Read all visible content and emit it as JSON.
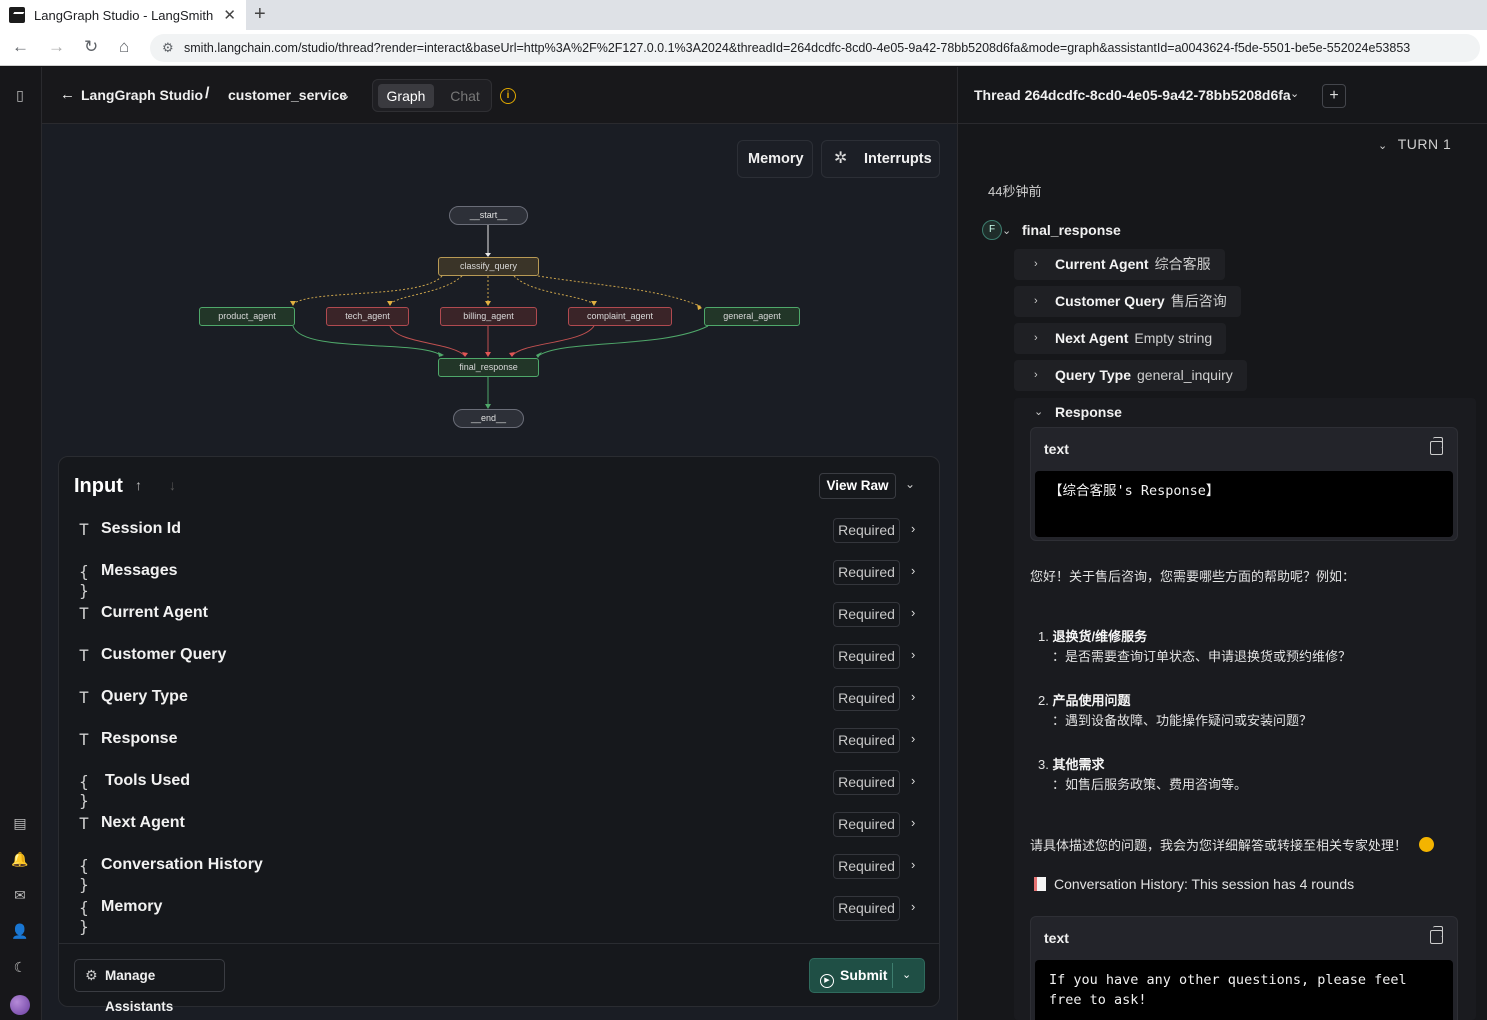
{
  "browser": {
    "tab_title": "LangGraph Studio - LangSmith",
    "url": "smith.langchain.com/studio/thread?render=interact&baseUrl=http%3A%2F%2F127.0.0.1%3A2024&threadId=264dcdfc-8cd0-4e05-9a42-78bb5208d6fa&mode=graph&assistantId=a0043624-f5de-5501-be5e-552024e53853"
  },
  "header": {
    "back_label": "LangGraph Studio",
    "separator": "/",
    "graph_name": "customer_service",
    "mode_graph": "Graph",
    "mode_chat": "Chat"
  },
  "graph": {
    "memory_button": "Memory",
    "interrupts_button": "Interrupts",
    "nodes": {
      "start": "__start__",
      "classify": "classify_query",
      "product": "product_agent",
      "tech": "tech_agent",
      "billing": "billing_agent",
      "complaint": "complaint_agent",
      "general": "general_agent",
      "final": "final_response",
      "end": "__end__"
    }
  },
  "input_panel": {
    "title": "Input",
    "view_raw": "View Raw",
    "required_label": "Required",
    "fields": [
      {
        "type_icon": "T",
        "label": "Session Id"
      },
      {
        "type_icon": "{ }",
        "label": "Messages"
      },
      {
        "type_icon": "T",
        "label": "Current Agent"
      },
      {
        "type_icon": "T",
        "label": "Customer Query"
      },
      {
        "type_icon": "T",
        "label": "Query Type"
      },
      {
        "type_icon": "T",
        "label": "Response"
      },
      {
        "type_icon": "{ }",
        "label": "Tools Used"
      },
      {
        "type_icon": "T",
        "label": "Next Agent"
      },
      {
        "type_icon": "{ }",
        "label": "Conversation History"
      },
      {
        "type_icon": "{ }",
        "label": "Memory"
      }
    ],
    "manage_assistants": "Manage Assistants",
    "submit": "Submit"
  },
  "thread": {
    "title": "Thread  264dcdfc-8cd0-4e05-9a42-78bb5208d6fa",
    "turn": "TURN 1",
    "time_ago": "44秒钟前",
    "node_badge": "F",
    "node_name": "final_response",
    "fields": [
      {
        "key": "Current Agent",
        "value": "综合客服"
      },
      {
        "key": "Customer Query",
        "value": "售后咨询"
      },
      {
        "key": "Next Agent",
        "value": "Empty string"
      },
      {
        "key": "Query Type",
        "value": "general_inquiry"
      }
    ],
    "response_label": "Response",
    "text_label": "text",
    "code1": "【综合客服's Response】",
    "intro": "您好！关于售后咨询，您需要哪些方面的帮助呢？例如：",
    "items": [
      {
        "n": "1.",
        "title": "退换货/维修服务",
        "desc": "：是否需要查询订单状态、申请退换货或预约维修？"
      },
      {
        "n": "2.",
        "title": "产品使用问题",
        "desc": "：遇到设备故障、功能操作疑问或安装问题？"
      },
      {
        "n": "3.",
        "title": "其他需求",
        "desc": "：如售后服务政策、费用咨询等。"
      }
    ],
    "closing": "请具体描述您的问题，我会为您详细解答或转接至相关专家处理！",
    "history_note": "Conversation History: This session has 4 rounds",
    "code2": "If you have any other questions, please feel\nfree to ask!"
  }
}
